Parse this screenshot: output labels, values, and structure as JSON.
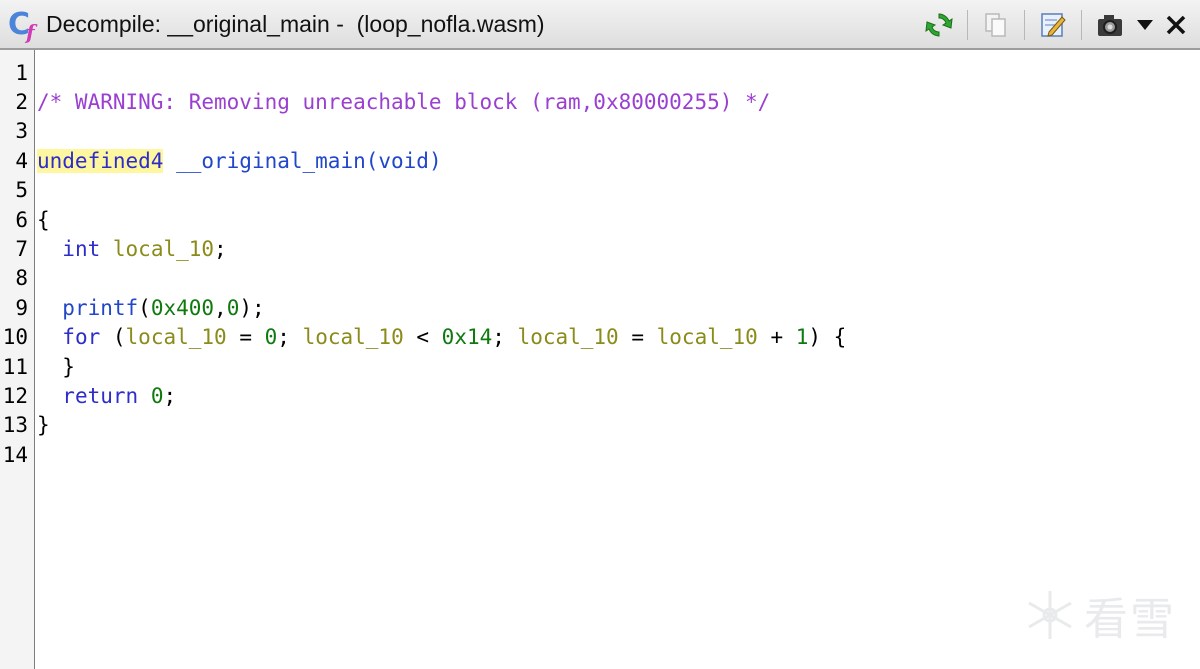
{
  "window": {
    "title": "Decompile: __original_main -  (loop_nofla.wasm)"
  },
  "toolbar": {
    "buttons": [
      {
        "name": "refresh-icon"
      },
      {
        "name": "copy-icon"
      },
      {
        "name": "edit-icon"
      },
      {
        "name": "snapshot-icon"
      },
      {
        "name": "dropdown-menu-icon"
      },
      {
        "name": "close-icon"
      }
    ]
  },
  "colors": {
    "comment": "#9a3fd1",
    "keyword": "#2d2dc9",
    "variable": "#8b8b1a",
    "number": "#0e7a0e",
    "highlight": "#fff6a0"
  },
  "code": {
    "line_numbers": [
      "1",
      "2",
      "3",
      "4",
      "5",
      "6",
      "7",
      "8",
      "9",
      "10",
      "11",
      "12",
      "13",
      "14"
    ],
    "l2_comment": "/* WARNING: Removing unreachable block (ram,0x80000255) */",
    "l4_type": "undefined4",
    "l4_sig": " __original_main(void)",
    "l6": "{",
    "l7_kw": "int",
    "l7_var": "local_10",
    "l7_end": ";",
    "l9_fn": "printf",
    "l9_open": "(",
    "l9_arg1": "0x400",
    "l9_comma": ",",
    "l9_arg2": "0",
    "l9_close": ");",
    "l10_kw": "for",
    "l10_p1": " (",
    "l10_v1": "local_10",
    "l10_eq1": " = ",
    "l10_n0": "0",
    "l10_s1": "; ",
    "l10_v2": "local_10",
    "l10_lt": " < ",
    "l10_n14": "0x14",
    "l10_s2": "; ",
    "l10_v3": "local_10",
    "l10_eq2": " = ",
    "l10_v4": "local_10",
    "l10_plus": " + ",
    "l10_n1": "1",
    "l10_end": ") {",
    "l11": "}",
    "l12_kw": "return",
    "l12_n": "0",
    "l12_end": ";",
    "l13": "}"
  },
  "watermark": {
    "text": "看雪"
  }
}
